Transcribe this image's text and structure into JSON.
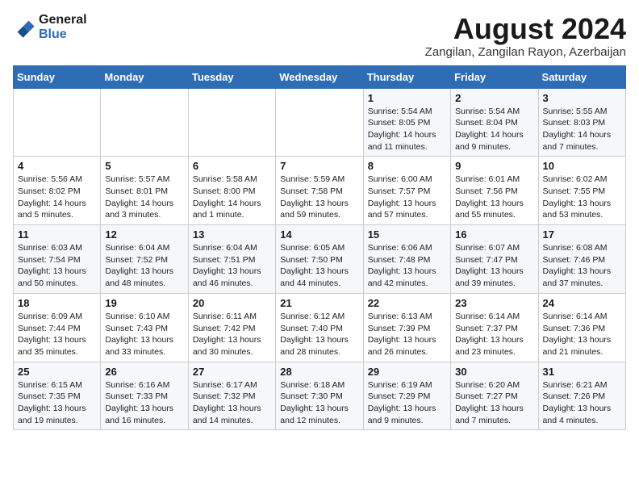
{
  "logo": {
    "text_general": "General",
    "text_blue": "Blue"
  },
  "header": {
    "title": "August 2024",
    "subtitle": "Zangilan, Zangilan Rayon, Azerbaijan"
  },
  "weekdays": [
    "Sunday",
    "Monday",
    "Tuesday",
    "Wednesday",
    "Thursday",
    "Friday",
    "Saturday"
  ],
  "weeks": [
    [
      {
        "day": "",
        "info": ""
      },
      {
        "day": "",
        "info": ""
      },
      {
        "day": "",
        "info": ""
      },
      {
        "day": "",
        "info": ""
      },
      {
        "day": "1",
        "info": "Sunrise: 5:54 AM\nSunset: 8:05 PM\nDaylight: 14 hours\nand 11 minutes."
      },
      {
        "day": "2",
        "info": "Sunrise: 5:54 AM\nSunset: 8:04 PM\nDaylight: 14 hours\nand 9 minutes."
      },
      {
        "day": "3",
        "info": "Sunrise: 5:55 AM\nSunset: 8:03 PM\nDaylight: 14 hours\nand 7 minutes."
      }
    ],
    [
      {
        "day": "4",
        "info": "Sunrise: 5:56 AM\nSunset: 8:02 PM\nDaylight: 14 hours\nand 5 minutes."
      },
      {
        "day": "5",
        "info": "Sunrise: 5:57 AM\nSunset: 8:01 PM\nDaylight: 14 hours\nand 3 minutes."
      },
      {
        "day": "6",
        "info": "Sunrise: 5:58 AM\nSunset: 8:00 PM\nDaylight: 14 hours\nand 1 minute."
      },
      {
        "day": "7",
        "info": "Sunrise: 5:59 AM\nSunset: 7:58 PM\nDaylight: 13 hours\nand 59 minutes."
      },
      {
        "day": "8",
        "info": "Sunrise: 6:00 AM\nSunset: 7:57 PM\nDaylight: 13 hours\nand 57 minutes."
      },
      {
        "day": "9",
        "info": "Sunrise: 6:01 AM\nSunset: 7:56 PM\nDaylight: 13 hours\nand 55 minutes."
      },
      {
        "day": "10",
        "info": "Sunrise: 6:02 AM\nSunset: 7:55 PM\nDaylight: 13 hours\nand 53 minutes."
      }
    ],
    [
      {
        "day": "11",
        "info": "Sunrise: 6:03 AM\nSunset: 7:54 PM\nDaylight: 13 hours\nand 50 minutes."
      },
      {
        "day": "12",
        "info": "Sunrise: 6:04 AM\nSunset: 7:52 PM\nDaylight: 13 hours\nand 48 minutes."
      },
      {
        "day": "13",
        "info": "Sunrise: 6:04 AM\nSunset: 7:51 PM\nDaylight: 13 hours\nand 46 minutes."
      },
      {
        "day": "14",
        "info": "Sunrise: 6:05 AM\nSunset: 7:50 PM\nDaylight: 13 hours\nand 44 minutes."
      },
      {
        "day": "15",
        "info": "Sunrise: 6:06 AM\nSunset: 7:48 PM\nDaylight: 13 hours\nand 42 minutes."
      },
      {
        "day": "16",
        "info": "Sunrise: 6:07 AM\nSunset: 7:47 PM\nDaylight: 13 hours\nand 39 minutes."
      },
      {
        "day": "17",
        "info": "Sunrise: 6:08 AM\nSunset: 7:46 PM\nDaylight: 13 hours\nand 37 minutes."
      }
    ],
    [
      {
        "day": "18",
        "info": "Sunrise: 6:09 AM\nSunset: 7:44 PM\nDaylight: 13 hours\nand 35 minutes."
      },
      {
        "day": "19",
        "info": "Sunrise: 6:10 AM\nSunset: 7:43 PM\nDaylight: 13 hours\nand 33 minutes."
      },
      {
        "day": "20",
        "info": "Sunrise: 6:11 AM\nSunset: 7:42 PM\nDaylight: 13 hours\nand 30 minutes."
      },
      {
        "day": "21",
        "info": "Sunrise: 6:12 AM\nSunset: 7:40 PM\nDaylight: 13 hours\nand 28 minutes."
      },
      {
        "day": "22",
        "info": "Sunrise: 6:13 AM\nSunset: 7:39 PM\nDaylight: 13 hours\nand 26 minutes."
      },
      {
        "day": "23",
        "info": "Sunrise: 6:14 AM\nSunset: 7:37 PM\nDaylight: 13 hours\nand 23 minutes."
      },
      {
        "day": "24",
        "info": "Sunrise: 6:14 AM\nSunset: 7:36 PM\nDaylight: 13 hours\nand 21 minutes."
      }
    ],
    [
      {
        "day": "25",
        "info": "Sunrise: 6:15 AM\nSunset: 7:35 PM\nDaylight: 13 hours\nand 19 minutes."
      },
      {
        "day": "26",
        "info": "Sunrise: 6:16 AM\nSunset: 7:33 PM\nDaylight: 13 hours\nand 16 minutes."
      },
      {
        "day": "27",
        "info": "Sunrise: 6:17 AM\nSunset: 7:32 PM\nDaylight: 13 hours\nand 14 minutes."
      },
      {
        "day": "28",
        "info": "Sunrise: 6:18 AM\nSunset: 7:30 PM\nDaylight: 13 hours\nand 12 minutes."
      },
      {
        "day": "29",
        "info": "Sunrise: 6:19 AM\nSunset: 7:29 PM\nDaylight: 13 hours\nand 9 minutes."
      },
      {
        "day": "30",
        "info": "Sunrise: 6:20 AM\nSunset: 7:27 PM\nDaylight: 13 hours\nand 7 minutes."
      },
      {
        "day": "31",
        "info": "Sunrise: 6:21 AM\nSunset: 7:26 PM\nDaylight: 13 hours\nand 4 minutes."
      }
    ]
  ]
}
